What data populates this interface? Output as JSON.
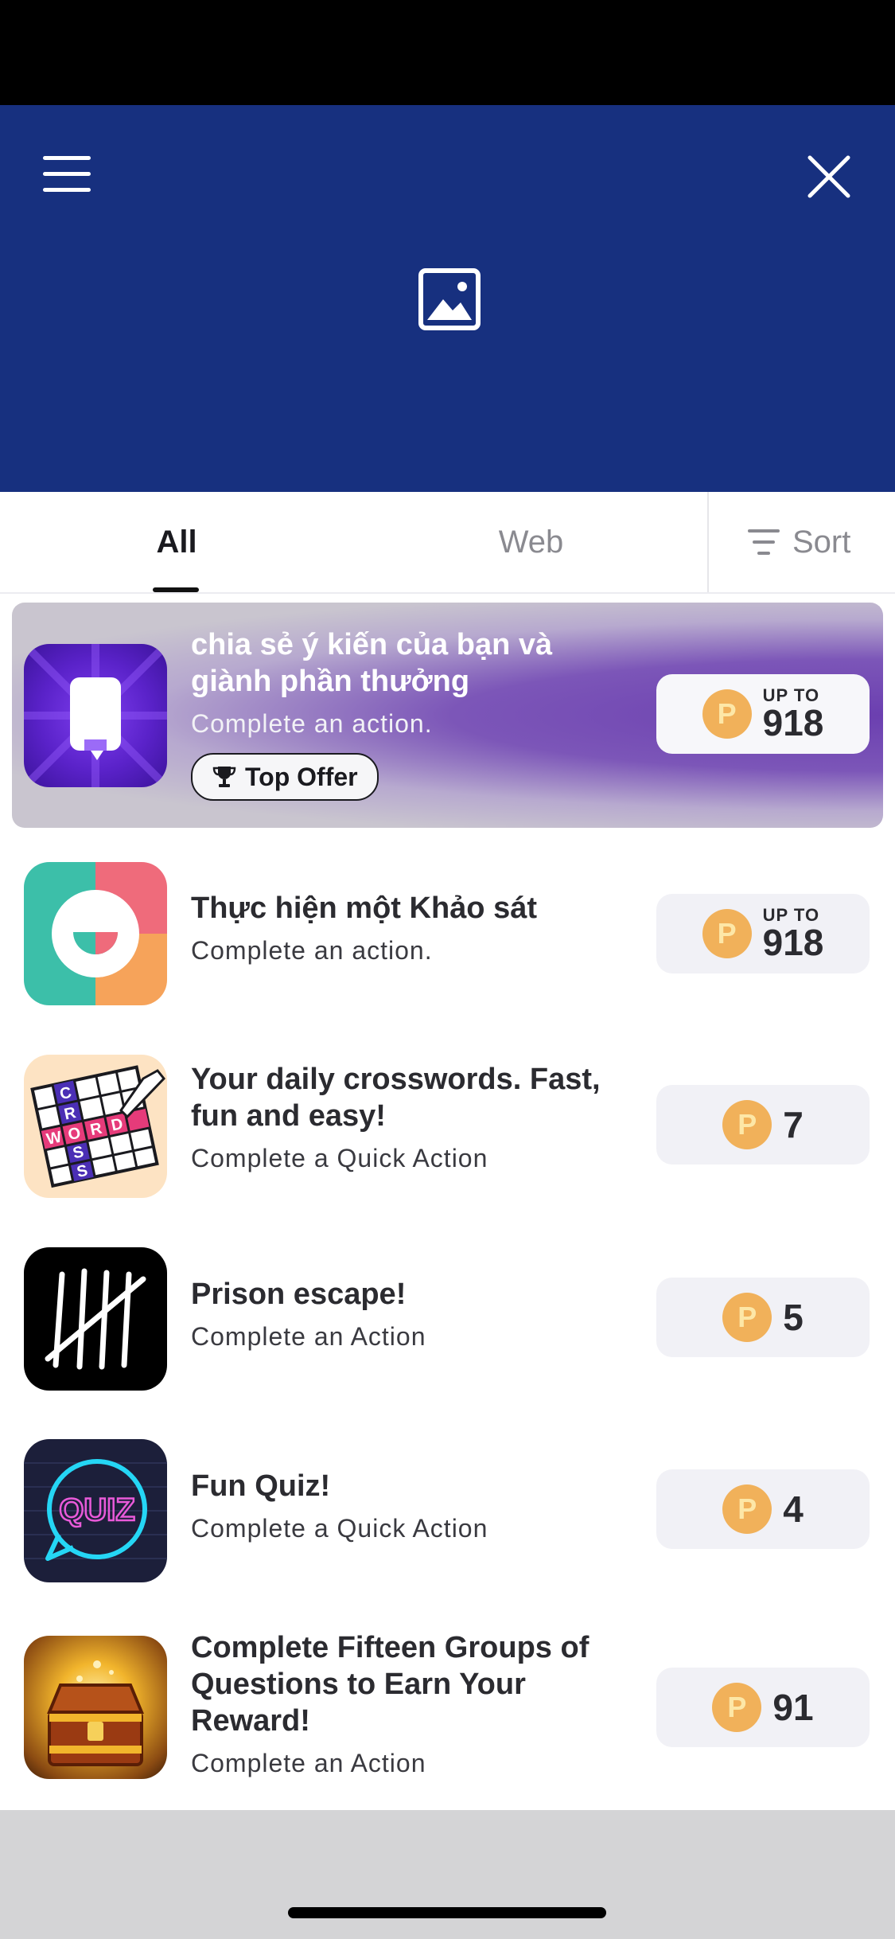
{
  "tabs": {
    "all": "All",
    "web": "Web",
    "sort": "Sort"
  },
  "featured": {
    "title": "chia sẻ ý kiến của bạn và giành phần thưởng",
    "subtitle": "Complete an action.",
    "badge": "Top Offer",
    "reward_prefix": "UP TO",
    "reward": "918",
    "icon": "phone-icon"
  },
  "offers": [
    {
      "title": "Thực hiện một Khảo sát",
      "subtitle": "Complete an action.",
      "reward_prefix": "UP TO",
      "reward": "918",
      "icon": "smile-logo-icon"
    },
    {
      "title": "Your daily crosswords. Fast, fun and easy!",
      "subtitle": "Complete a Quick Action",
      "reward": "7",
      "icon": "crossword-icon"
    },
    {
      "title": "Prison escape!",
      "subtitle": "Complete an Action",
      "reward": "5",
      "icon": "tally-marks-icon"
    },
    {
      "title": "Fun Quiz!",
      "subtitle": "Complete a Quick Action",
      "reward": "4",
      "icon": "quiz-bubble-icon"
    },
    {
      "title": "Complete Fifteen Groups of Questions to Earn Your Reward!",
      "subtitle": "Complete an Action",
      "reward": "91",
      "icon": "treasure-chest-icon"
    }
  ],
  "coin_letter": "P",
  "icon_letters": {
    "crossword": "CROSSWORD",
    "quiz": "QUIZ"
  },
  "colors": {
    "header_bg": "#17307f",
    "coin": "#f1b15a",
    "reward_bg": "#f1f1f6"
  }
}
